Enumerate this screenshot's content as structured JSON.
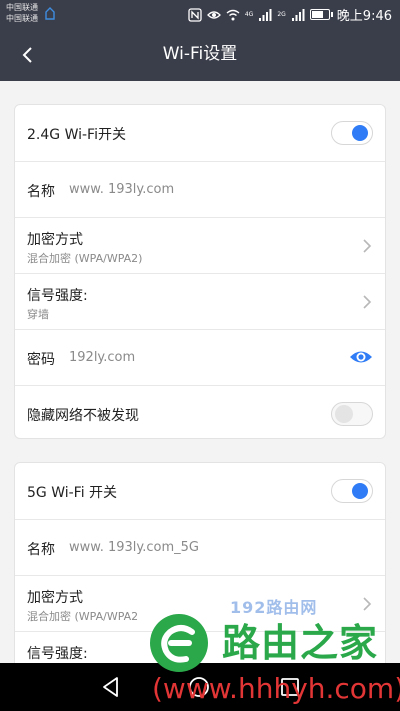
{
  "status_bar": {
    "carrier1": "中国联通",
    "carrier2": "中国联通",
    "signal1": "4G",
    "signal2": "2G",
    "time": "晚上9:46",
    "battery_level": 0.7
  },
  "header": {
    "title": "Wi-Fi设置"
  },
  "band_24g": {
    "switch_label": "2.4G Wi-Fi开关",
    "switch_on": true,
    "name_label": "名称",
    "name_value": "www. 193ly.com",
    "encryption_label": "加密方式",
    "encryption_value": "混合加密 (WPA/WPA2)",
    "signal_label": "信号强度:",
    "signal_value": "穿墙",
    "password_label": "密码",
    "password_value": "192ly.com",
    "hide_label": "隐藏网络不被发现",
    "hide_on": false
  },
  "band_5g": {
    "switch_label": "5G Wi-Fi 开关",
    "switch_on": true,
    "name_label": "名称",
    "name_value": "www. 193ly.com_5G",
    "encryption_label": "加密方式",
    "encryption_value": "混合加密 (WPA/WPA2",
    "signal_label": "信号强度:"
  },
  "watermark": {
    "brand": "路由之家",
    "url": "(www.hhhyh.com)",
    "ghost_text": "192路由网"
  },
  "colors": {
    "header_bg": "#3a3d4a",
    "accent": "#2f7cf6",
    "watermark_green": "#2aa84a",
    "watermark_red": "#e23535"
  }
}
